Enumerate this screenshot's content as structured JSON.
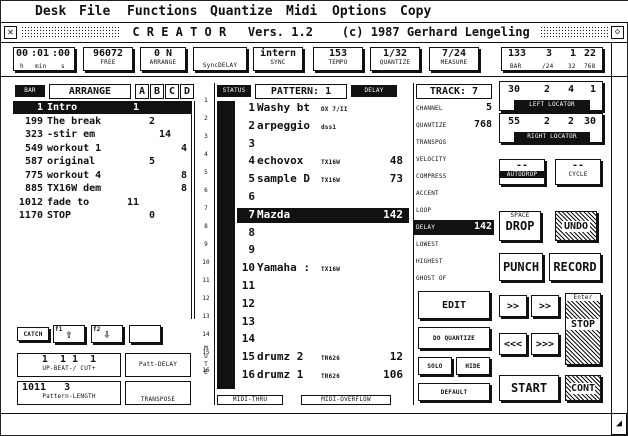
{
  "menu": [
    "Desk",
    "File",
    "Functions",
    "Quantize",
    "Midi",
    "Options",
    "Copy"
  ],
  "title": "C R E A T O R   Vers. 1.2    (c) 1987 Gerhard Lengeling",
  "toolbar": {
    "time": {
      "h": "00",
      "min": "01",
      "s": "00",
      "lh": "h",
      "lmin": "min",
      "ls": "s"
    },
    "free": {
      "value": "96072",
      "label": "FREE"
    },
    "arrange": {
      "value": "0 N",
      "label": "ARRANGE"
    },
    "syncdelay": {
      "label": "SyncDELAY"
    },
    "sync": {
      "value": "intern",
      "label": "SYNC"
    },
    "tempo": {
      "value": "153",
      "label": "TEMPO"
    },
    "quantize": {
      "value": "1/32",
      "label": "QUANTIZE"
    },
    "measure": {
      "value": "7/24",
      "label": "MEASURE"
    },
    "position": {
      "v1": "133",
      "v2": "3",
      "v3": "1",
      "v4": "22",
      "l1": "BAR",
      "l2": "/24",
      "l3": "32",
      "l4": "768"
    }
  },
  "arrange": {
    "bar_label": "BAR",
    "header": "ARRANGE",
    "cols": [
      "A",
      "B",
      "C",
      "D"
    ],
    "rows": [
      {
        "bar": "1",
        "name": "Intro",
        "a": "1",
        "b": "",
        "c": "",
        "d": ""
      },
      {
        "bar": "199",
        "name": "The break",
        "a": "",
        "b": "2",
        "c": "",
        "d": ""
      },
      {
        "bar": "323",
        "name": "-stir em",
        "a": "",
        "b": "",
        "c": "14",
        "d": ""
      },
      {
        "bar": "549",
        "name": "workout 1",
        "a": "",
        "b": "",
        "c": "",
        "d": "4"
      },
      {
        "bar": "587",
        "name": "original",
        "a": "",
        "b": "5",
        "c": "",
        "d": ""
      },
      {
        "bar": "775",
        "name": "workout 4",
        "a": "",
        "b": "",
        "c": "",
        "d": "8"
      },
      {
        "bar": "885",
        "name": "TX16W dem",
        "a": "",
        "b": "",
        "c": "",
        "d": "8"
      },
      {
        "bar": "1012",
        "name": "fade to",
        "a": "11",
        "b": "",
        "c": "",
        "d": ""
      },
      {
        "bar": "1170",
        "name": "STOP",
        "a": "",
        "b": "0",
        "c": "",
        "d": ""
      }
    ],
    "catch": "CATCH",
    "f1": "f1",
    "f2": "f2",
    "upbeat": {
      "values": "1  1 1  1",
      "label": "UP-BEAT-/ CUT+"
    },
    "pattdelay": "Patt-DELAY",
    "pattlength": {
      "value": "1011   3",
      "label": "Pattern-LENGTH"
    },
    "transpose": "TRANSPOSE"
  },
  "patterns": {
    "status": "STATUS",
    "header": "PATTERN: 1",
    "delay": "DELAY",
    "mute": "M\nU\nT\nE",
    "rows": [
      {
        "num": "1",
        "name": "Washy bt",
        "dev": "DX 7/II",
        "val": ""
      },
      {
        "num": "2",
        "name": "arpeggio",
        "dev": "dss1",
        "val": ""
      },
      {
        "num": "3",
        "name": "",
        "dev": "",
        "val": ""
      },
      {
        "num": "4",
        "name": "echovox",
        "dev": "TX16W",
        "val": "48"
      },
      {
        "num": "5",
        "name": "sample D",
        "dev": "TX16W",
        "val": "73"
      },
      {
        "num": "6",
        "name": "",
        "dev": "",
        "val": ""
      },
      {
        "num": "7",
        "name": "Mazda",
        "dev": "",
        "val": "142"
      },
      {
        "num": "8",
        "name": "",
        "dev": "",
        "val": ""
      },
      {
        "num": "9",
        "name": "",
        "dev": "",
        "val": ""
      },
      {
        "num": "10",
        "name": "Yamaha :",
        "dev": "TX16W",
        "val": ""
      },
      {
        "num": "11",
        "name": "",
        "dev": "",
        "val": ""
      },
      {
        "num": "12",
        "name": "",
        "dev": "",
        "val": ""
      },
      {
        "num": "13",
        "name": "",
        "dev": "",
        "val": ""
      },
      {
        "num": "14",
        "name": "",
        "dev": "",
        "val": ""
      },
      {
        "num": "15",
        "name": "drumz 2",
        "dev": "TR626",
        "val": "12"
      },
      {
        "num": "16",
        "name": "drumz 1",
        "dev": "TR626",
        "val": "106"
      }
    ],
    "midithru": "MIDI-THRU",
    "midioverflow": "MIDI-OVERFLOW"
  },
  "track": {
    "header": "TRACK: 7",
    "rows": [
      {
        "label": "CHANNEL",
        "val": "5"
      },
      {
        "label": "QUANTIZE",
        "val": "768"
      },
      {
        "label": "TRANSPOS",
        "val": ""
      },
      {
        "label": "VELOCITY",
        "val": ""
      },
      {
        "label": "COMPRESS",
        "val": ""
      },
      {
        "label": "ACCENT",
        "val": ""
      },
      {
        "label": "LOOP",
        "val": ""
      },
      {
        "label": "DELAY",
        "val": "142"
      },
      {
        "label": "LOWEST",
        "val": ""
      },
      {
        "label": "HIGHEST",
        "val": ""
      },
      {
        "label": "GHOST OF",
        "val": ""
      }
    ],
    "edit": "EDIT",
    "doquantize": "DO QUANTIZE",
    "solo": "SOLO",
    "hide": "HIDE",
    "default": "DEFAULT"
  },
  "locators": {
    "left": {
      "v1": "30",
      "v2": "2",
      "v3": "4",
      "v4": "1",
      "label": "LEFT LOCATOR"
    },
    "right": {
      "v1": "55",
      "v2": "2",
      "v3": "2",
      "v4": "30",
      "label": "RIGHT LOCATOR"
    },
    "autodrop": {
      "value": "--",
      "label": "AUTODROP"
    },
    "cycle": {
      "value": "--",
      "label": "CYCLE"
    }
  },
  "transport": {
    "space": "SPACE",
    "drop": "DROP",
    "undo": "UNDO",
    "punch": "PUNCH",
    "record": "RECORD",
    "enter": "Enter",
    "stop": "STOP",
    "start": "START",
    "cont": "CONT",
    "ff": ">>",
    "rew": "<<",
    "fff": ">>>",
    "rrr": "<<<"
  }
}
